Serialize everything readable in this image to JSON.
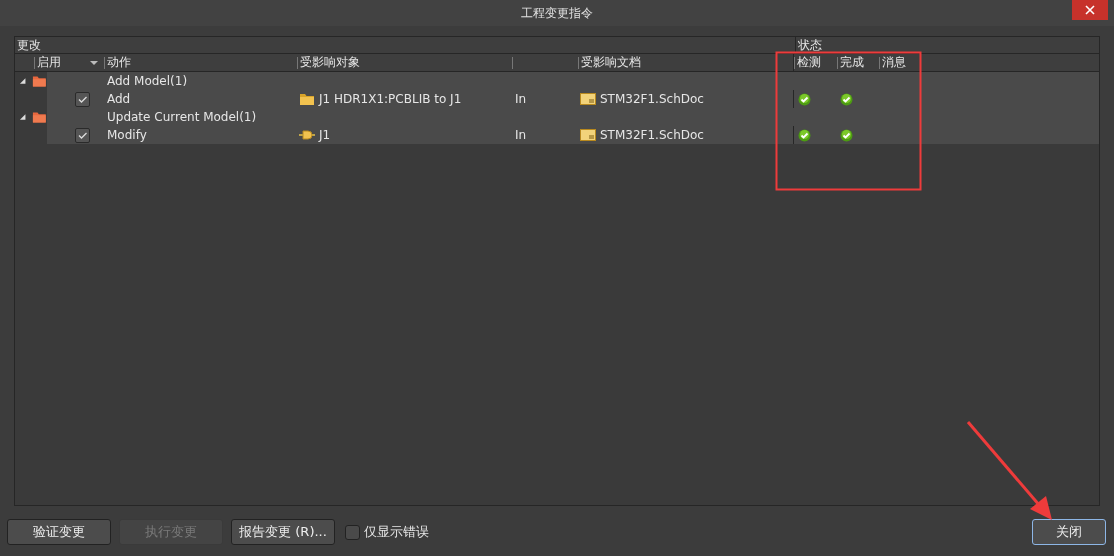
{
  "window": {
    "title": "工程变更指令"
  },
  "group_headers": [
    {
      "label": "更改"
    },
    {
      "label": "状态"
    }
  ],
  "columns": [
    {
      "label": "启用",
      "dropdown": true
    },
    {
      "label": "动作"
    },
    {
      "label": "受影响对象"
    },
    {
      "label": "受影响文档"
    },
    {
      "label": "检测"
    },
    {
      "label": "完成"
    },
    {
      "label": "消息"
    }
  ],
  "changes": [
    {
      "label": "Add Model(1)",
      "expanded": true,
      "children": [
        {
          "enabled": true,
          "action": "Add",
          "kind": "folder",
          "object": "J1 HDR1X1:PCBLIB to J1",
          "scope": "In",
          "document": "STM32F1.SchDoc",
          "check_ok": true,
          "done_ok": true
        }
      ]
    },
    {
      "label": "Update Current Model(1)",
      "expanded": true,
      "children": [
        {
          "enabled": true,
          "action": "Modify",
          "kind": "component",
          "object": "J1",
          "scope": "In",
          "document": "STM32F1.SchDoc",
          "check_ok": true,
          "done_ok": true
        }
      ]
    }
  ],
  "buttons": [
    {
      "label": "验证变更",
      "disabled": false
    },
    {
      "label": "执行变更",
      "disabled": true
    },
    {
      "label": "报告变更 (R)...",
      "disabled": false
    }
  ],
  "errors_only": {
    "label": "仅显示错误",
    "checked": false
  },
  "close_button": {
    "label": "关闭",
    "focused": true
  }
}
